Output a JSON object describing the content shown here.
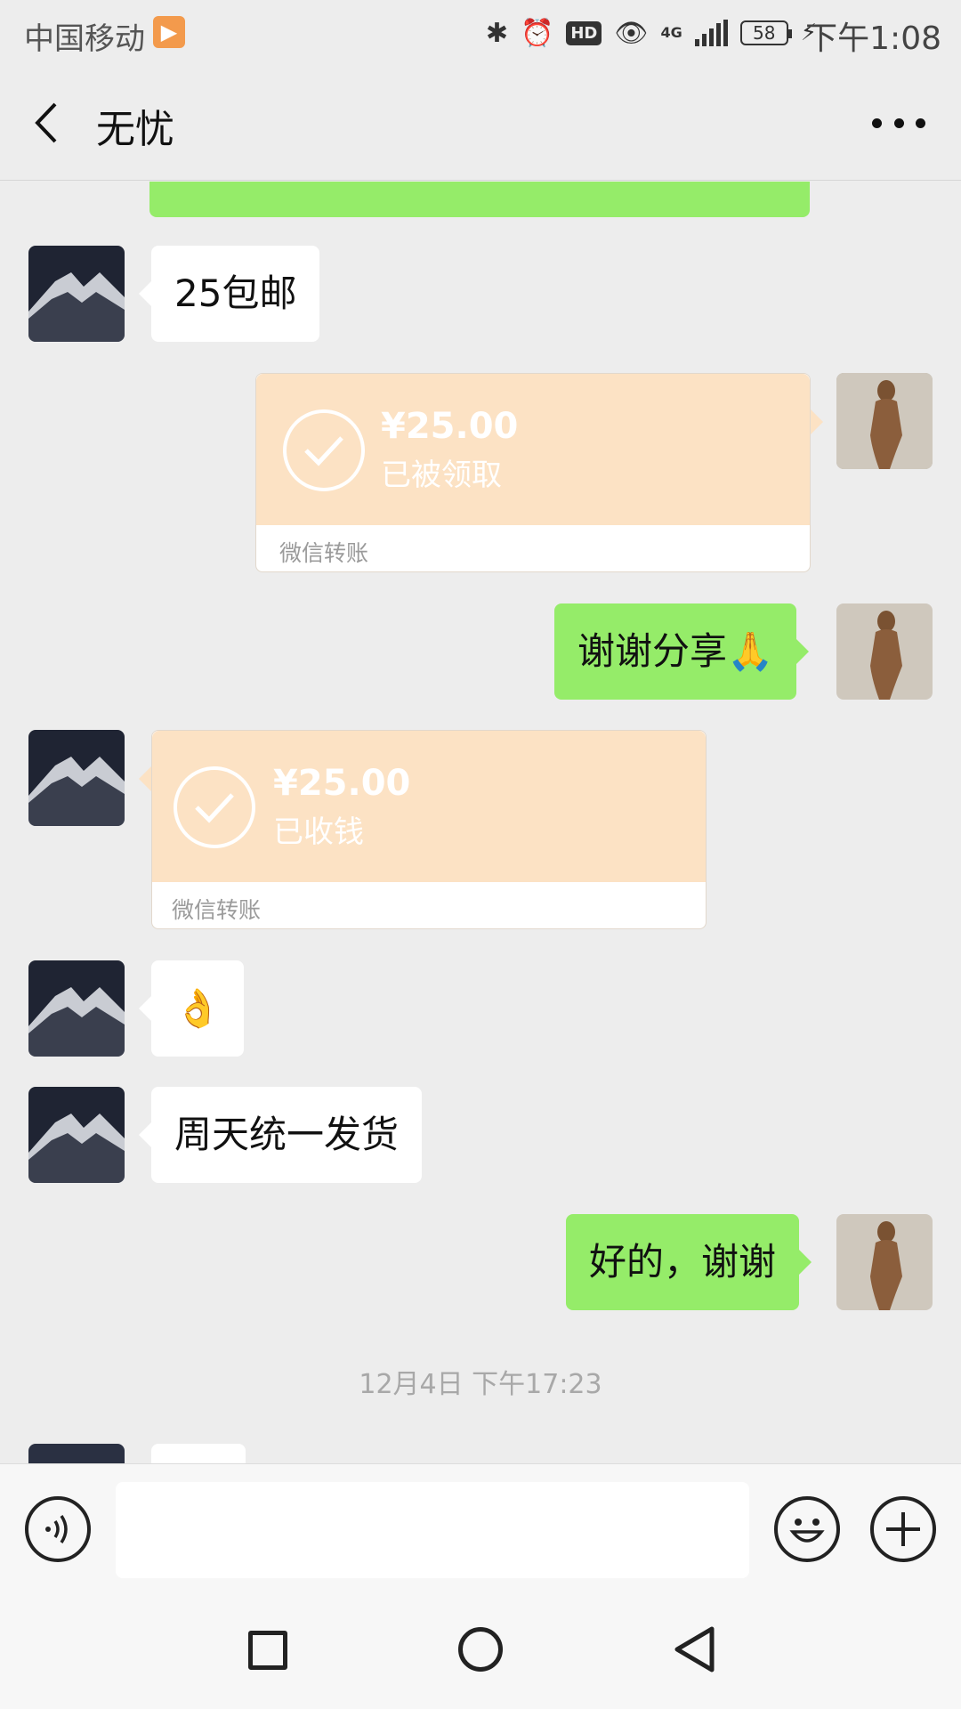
{
  "status_bar": {
    "carrier": "中国移动",
    "app_badge_icon": "play-badge-icon",
    "network": "4G",
    "battery": "58",
    "time": "下午1:08"
  },
  "header": {
    "title": "无忧",
    "back_icon": "chevron-left-icon",
    "more_icon": "more-dots-icon"
  },
  "messages": [
    {
      "from": "other",
      "type": "text",
      "text": "25包邮"
    },
    {
      "from": "me",
      "type": "transfer",
      "amount": "¥25.00",
      "status": "已被领取",
      "footer": "微信转账"
    },
    {
      "from": "me",
      "type": "text",
      "text": "谢谢分享🙏"
    },
    {
      "from": "other",
      "type": "transfer",
      "amount": "¥25.00",
      "status": "已收钱",
      "footer": "微信转账"
    },
    {
      "from": "other",
      "type": "text",
      "text": "👌"
    },
    {
      "from": "other",
      "type": "text",
      "text": "周天统一发货"
    },
    {
      "from": "me",
      "type": "text",
      "text": "好的，谢谢"
    }
  ],
  "timestamp": "12月4日 下午17:23",
  "input_bar": {
    "voice_icon": "voice-icon",
    "input_value": "",
    "emoji_icon": "emoji-icon",
    "plus_icon": "plus-icon"
  },
  "colors": {
    "background": "#ededed",
    "my_bubble": "#95ec69",
    "their_bubble": "#ffffff",
    "transfer_top": "#fce2c4"
  }
}
